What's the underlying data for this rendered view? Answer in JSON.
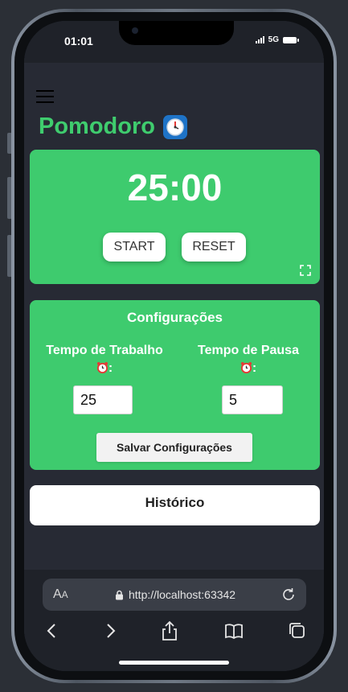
{
  "status_bar": {
    "time": "01:01",
    "network": "5G"
  },
  "app": {
    "title": "Pomodoro"
  },
  "timer": {
    "display": "25:00",
    "start_label": "START",
    "reset_label": "RESET"
  },
  "config": {
    "title": "Configurações",
    "work_label": "Tempo de Trabalho",
    "pause_label": "Tempo de Pausa",
    "label_suffix": ":",
    "work_value": "25",
    "pause_value": "5",
    "save_label": "Salvar Configurações"
  },
  "history": {
    "title": "Histórico"
  },
  "browser": {
    "text_size_label": "A",
    "text_size_small": "A",
    "url": "http://localhost:63342"
  },
  "colors": {
    "accent": "#3ecb6e",
    "title_green": "#3fcc6e",
    "background": "#272a34"
  },
  "icons": [
    "hamburger-icon",
    "timer-clock-icon",
    "fullscreen-icon",
    "alarm-clock-icon",
    "lock-icon",
    "reload-icon",
    "back-icon",
    "forward-icon",
    "share-icon",
    "bookmarks-icon",
    "tabs-icon"
  ]
}
